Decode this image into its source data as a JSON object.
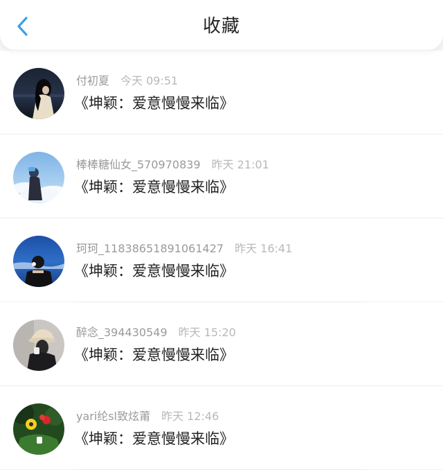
{
  "header": {
    "title": "收藏",
    "back_icon": "chevron-left-icon",
    "accent_color": "#3aa0e8"
  },
  "favorites": [
    {
      "user": "付初夏",
      "time": "今天 09:51",
      "book": "《坤颖：爱意慢慢来临》",
      "avatar": "night-sea-girl"
    },
    {
      "user": "棒棒糖仙女_570970839",
      "time": "昨天 21:01",
      "book": "《坤颖：爱意慢慢来临》",
      "avatar": "sky-girl"
    },
    {
      "user": "珂珂_11838651891061427",
      "time": "昨天 16:41",
      "book": "《坤颖：爱意慢慢来临》",
      "avatar": "ocean-girl"
    },
    {
      "user": "醉念_394430549",
      "time": "昨天 15:20",
      "book": "《坤颖：爱意慢慢来临》",
      "avatar": "hat-girl"
    },
    {
      "user": "yari纶sl致炫莆",
      "time": "昨天 12:46",
      "book": "《坤颖：爱意慢慢来临》",
      "avatar": "toys-green"
    }
  ]
}
